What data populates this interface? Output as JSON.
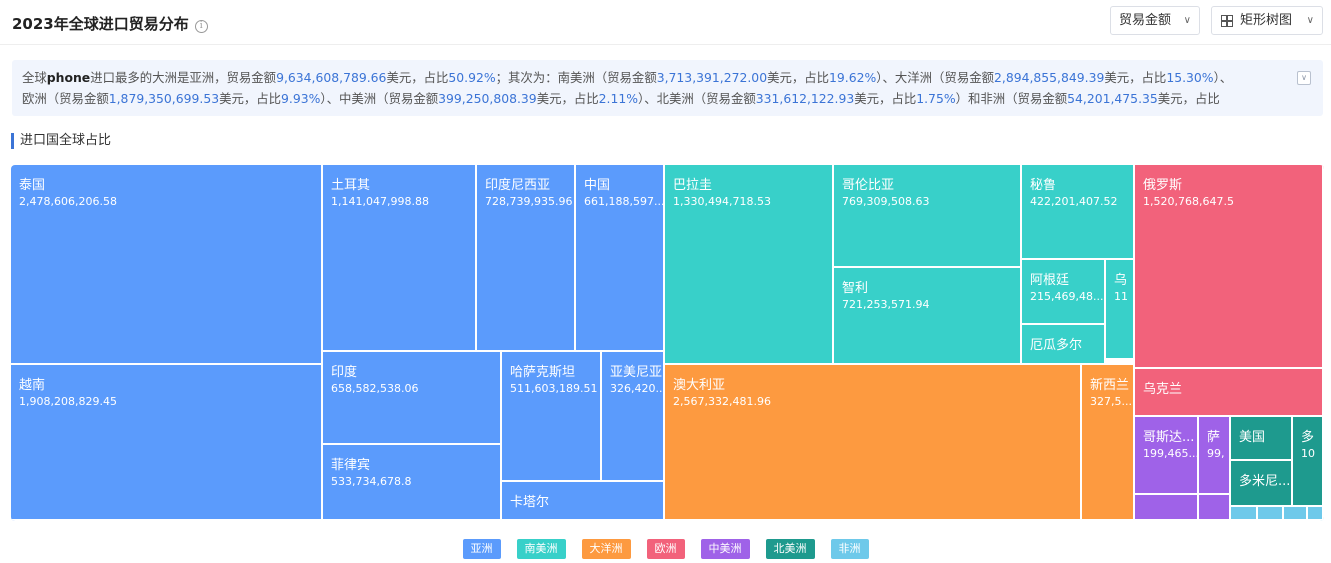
{
  "page": {
    "title": "2023年全球进口贸易分布",
    "info_icon": "info-icon",
    "metric_select": "贸易金额",
    "chart_select": "矩形树图",
    "section_title": "进口国全球占比"
  },
  "summary": {
    "line1": [
      {
        "t": "全球",
        "c": "txt"
      },
      {
        "t": "phone",
        "c": "bold"
      },
      {
        "t": "进口最多的大洲是亚洲，贸易金额",
        "c": "txt"
      },
      {
        "t": "9,634,608,789.66",
        "c": "num"
      },
      {
        "t": "美元，占比",
        "c": "txt"
      },
      {
        "t": "50.92%",
        "c": "num"
      },
      {
        "t": "；其次为：南美洲（贸易金额",
        "c": "txt"
      },
      {
        "t": "3,713,391,272.00",
        "c": "num"
      },
      {
        "t": "美元，占比",
        "c": "txt"
      },
      {
        "t": "19.62%",
        "c": "num"
      },
      {
        "t": "）、大洋洲（贸易金额",
        "c": "txt"
      },
      {
        "t": "2,894,855,849.39",
        "c": "num"
      },
      {
        "t": "美元，占比",
        "c": "txt"
      },
      {
        "t": "15.30%",
        "c": "num"
      },
      {
        "t": "）、",
        "c": "txt"
      }
    ],
    "line2": [
      {
        "t": "欧洲（贸易金额",
        "c": "txt"
      },
      {
        "t": "1,879,350,699.53",
        "c": "num"
      },
      {
        "t": "美元，占比",
        "c": "txt"
      },
      {
        "t": "9.93%",
        "c": "num"
      },
      {
        "t": "）、中美洲（贸易金额",
        "c": "txt"
      },
      {
        "t": "399,250,808.39",
        "c": "num"
      },
      {
        "t": "美元，占比",
        "c": "txt"
      },
      {
        "t": "2.11%",
        "c": "num"
      },
      {
        "t": "）、北美洲（贸易金额",
        "c": "txt"
      },
      {
        "t": "331,612,122.93",
        "c": "num"
      },
      {
        "t": "美元，占比",
        "c": "txt"
      },
      {
        "t": "1.75%",
        "c": "num"
      },
      {
        "t": "）和非洲（贸易金额",
        "c": "txt"
      },
      {
        "t": "54,201,475.35",
        "c": "num"
      },
      {
        "t": "美元，占比",
        "c": "txt"
      }
    ]
  },
  "chart_data": {
    "type": "treemap",
    "groups": [
      {
        "name": "亚洲",
        "color": "#5b9bfc",
        "items": [
          {
            "name": "泰国",
            "value": "2,478,606,206.58"
          },
          {
            "name": "越南",
            "value": "1,908,208,829.45"
          },
          {
            "name": "土耳其",
            "value": "1,141,047,998.88"
          },
          {
            "name": "印度尼西亚",
            "value": "728,739,935.96"
          },
          {
            "name": "中国",
            "value": "661,188,597...."
          },
          {
            "name": "印度",
            "value": "658,582,538.06"
          },
          {
            "name": "菲律宾",
            "value": "533,734,678.8"
          },
          {
            "name": "哈萨克斯坦",
            "value": "511,603,189.51"
          },
          {
            "name": "亚美尼亚",
            "value": "326,420..."
          },
          {
            "name": "卡塔尔",
            "value": ""
          }
        ]
      },
      {
        "name": "南美洲",
        "color": "#38d0c9",
        "items": [
          {
            "name": "巴拉圭",
            "value": "1,330,494,718.53"
          },
          {
            "name": "哥伦比亚",
            "value": "769,309,508.63"
          },
          {
            "name": "智利",
            "value": "721,253,571.94"
          },
          {
            "name": "秘鲁",
            "value": "422,201,407.52"
          },
          {
            "name": "阿根廷",
            "value": "215,469,48..."
          },
          {
            "name": "乌",
            "value": "11"
          },
          {
            "name": "厄瓜多尔",
            "value": ""
          }
        ]
      },
      {
        "name": "大洋洲",
        "color": "#fd9a40",
        "items": [
          {
            "name": "澳大利亚",
            "value": "2,567,332,481.96"
          },
          {
            "name": "新西兰",
            "value": "327,5..."
          }
        ]
      },
      {
        "name": "欧洲",
        "color": "#f2627b",
        "items": [
          {
            "name": "俄罗斯",
            "value": "1,520,768,647.5"
          },
          {
            "name": "乌克兰",
            "value": ""
          }
        ]
      },
      {
        "name": "中美洲",
        "color": "#9f62e8",
        "items": [
          {
            "name": "哥斯达...",
            "value": "199,465..."
          },
          {
            "name": "萨",
            "value": "99,"
          },
          {
            "name": "",
            "value": ""
          },
          {
            "name": "",
            "value": ""
          }
        ]
      },
      {
        "name": "北美洲",
        "color": "#1e9a8e",
        "items": [
          {
            "name": "美国",
            "value": ""
          },
          {
            "name": "多",
            "value": "10"
          },
          {
            "name": "多米尼...",
            "value": ""
          }
        ]
      },
      {
        "name": "非洲",
        "color": "#6ec9ea",
        "items": [
          {
            "name": "",
            "value": ""
          },
          {
            "name": "",
            "value": ""
          },
          {
            "name": "",
            "value": ""
          },
          {
            "name": "",
            "value": ""
          }
        ]
      }
    ],
    "legend": [
      "亚洲",
      "南美洲",
      "大洋洲",
      "欧洲",
      "中美洲",
      "北美洲",
      "非洲"
    ]
  }
}
